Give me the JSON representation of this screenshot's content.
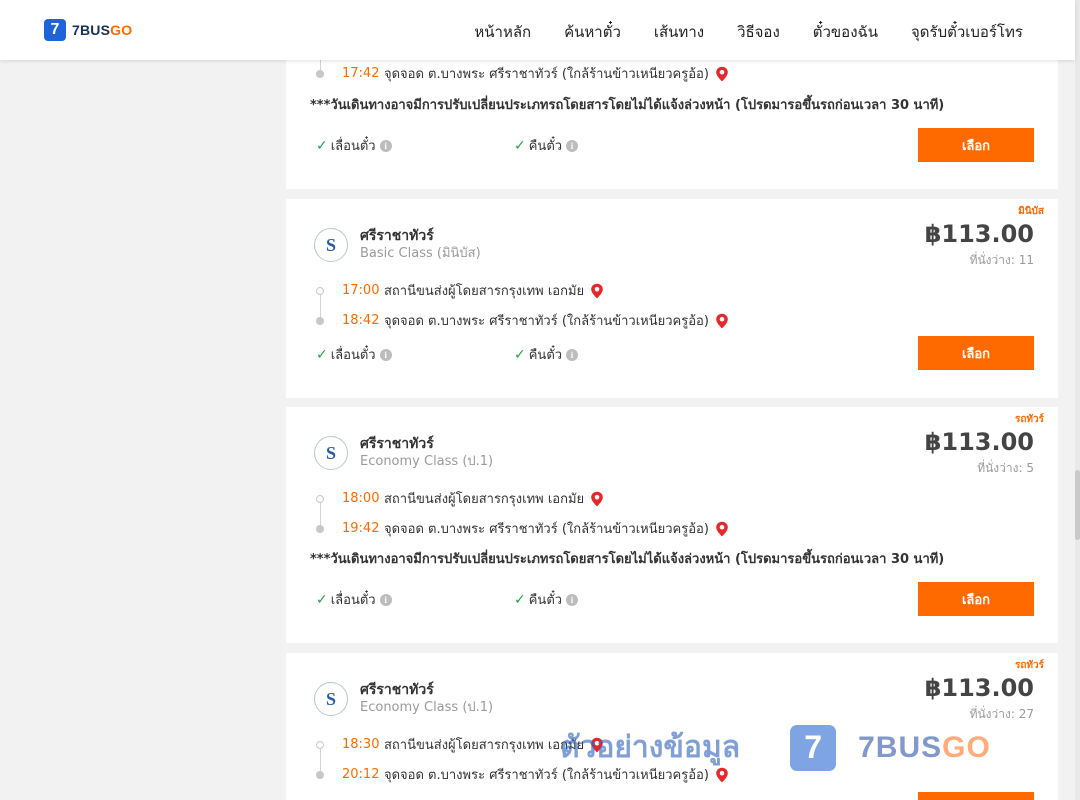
{
  "brand": {
    "badge": "7",
    "name_main": "7BUS",
    "name_accent": "GO"
  },
  "nav": [
    "หน้าหลัก",
    "ค้นหาตั๋ว",
    "เส้นทาง",
    "วิธีจอง",
    "ตั๋วของฉัน",
    "จุดรับตั๋วเบอร์โทร"
  ],
  "icons": {
    "operator_logo": "S",
    "check": "✓",
    "info": "i"
  },
  "colors": {
    "accent": "#ff6a00",
    "brand_blue": "#1f63d8",
    "check_green": "#25a145"
  },
  "card0": {
    "arrive_time": "17:42",
    "arrive_place": "จุดจอด ต.บางพระ ศรีราชาทัวร์ (ใกล้ร้านข้าวเหนียวครูอ้อ)",
    "notice": "***วันเดินทางอาจมีการปรับเปลี่ยนประเภทรถโดยสารโดยไม่ได้แจ้งล่วงหน้า (โปรดมารอขึ้นรถก่อนเวลา 30 นาที)",
    "feature1": "เลื่อนตั๋ว",
    "feature2": "คืนตั๋ว",
    "button": "เลือก"
  },
  "card1": {
    "tag": "มินิบัส",
    "operator": "ศรีราชาทัวร์",
    "class": "Basic Class (มินิบัส)",
    "price": "฿113.00",
    "seats": "ที่นั่งว่าง: 11",
    "depart_time": "17:00",
    "depart_place": "สถานีขนส่งผู้โดยสารกรุงเทพ เอกมัย",
    "arrive_time": "18:42",
    "arrive_place": "จุดจอด ต.บางพระ ศรีราชาทัวร์ (ใกล้ร้านข้าวเหนียวครูอ้อ)",
    "feature1": "เลื่อนตั๋ว",
    "feature2": "คืนตั๋ว",
    "button": "เลือก"
  },
  "card2": {
    "tag": "รถทัวร์",
    "operator": "ศรีราชาทัวร์",
    "class": "Economy Class (ป.1)",
    "price": "฿113.00",
    "seats": "ที่นั่งว่าง: 5",
    "depart_time": "18:00",
    "depart_place": "สถานีขนส่งผู้โดยสารกรุงเทพ เอกมัย",
    "arrive_time": "19:42",
    "arrive_place": "จุดจอด ต.บางพระ ศรีราชาทัวร์ (ใกล้ร้านข้าวเหนียวครูอ้อ)",
    "notice": "***วันเดินทางอาจมีการปรับเปลี่ยนประเภทรถโดยสารโดยไม่ได้แจ้งล่วงหน้า (โปรดมารอขึ้นรถก่อนเวลา 30 นาที)",
    "feature1": "เลื่อนตั๋ว",
    "feature2": "คืนตั๋ว",
    "button": "เลือก"
  },
  "card3": {
    "tag": "รถทัวร์",
    "operator": "ศรีราชาทัวร์",
    "class": "Economy Class (ป.1)",
    "price": "฿113.00",
    "seats": "ที่นั่งว่าง: 27",
    "depart_time": "18:30",
    "depart_place": "สถานีขนส่งผู้โดยสารกรุงเทพ เอกมัย",
    "arrive_time": "20:12",
    "arrive_place": "จุดจอด ต.บางพระ ศรีราชาทัวร์ (ใกล้ร้านข้าวเหนียวครูอ้อ)"
  },
  "watermark": {
    "text": "ตัวอย่างข้อมูล",
    "badge": "7",
    "logo_main": "7BUS",
    "logo_accent": "GO"
  }
}
